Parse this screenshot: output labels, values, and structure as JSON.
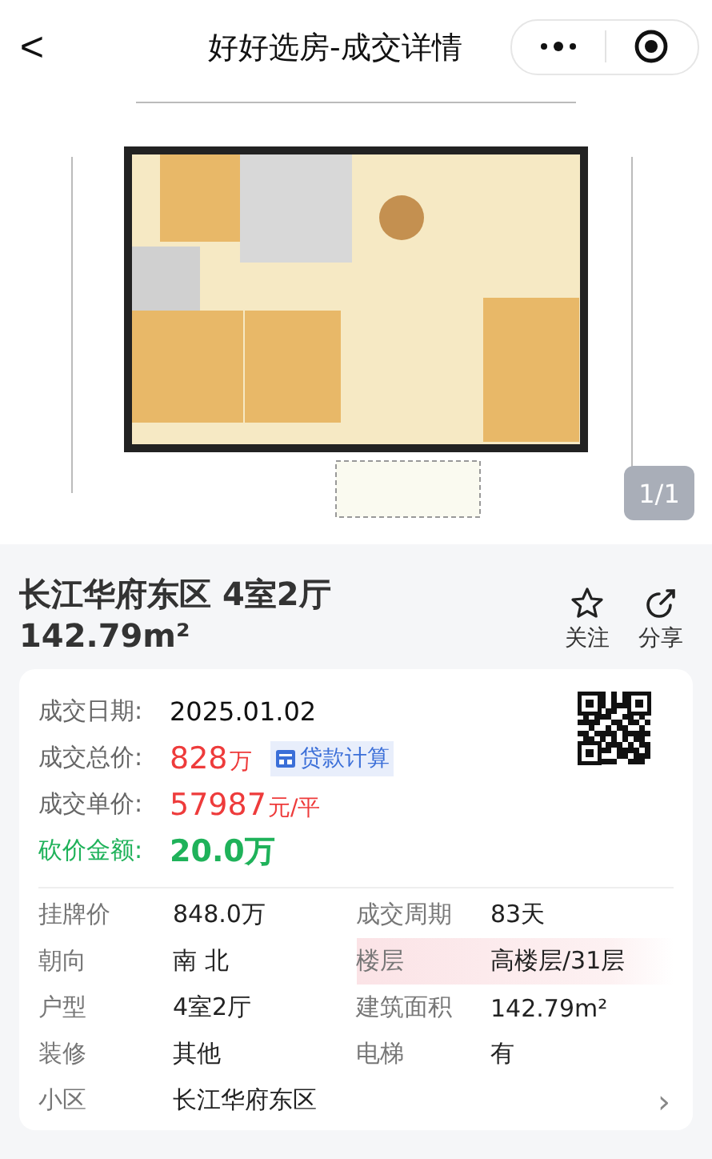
{
  "nav": {
    "back": "<",
    "title": "好好选房-成交详情"
  },
  "gallery": {
    "kind": "picture",
    "counter": "1/1"
  },
  "header": {
    "title": "长江华府东区 4室2厅",
    "area": "142.79m²",
    "actions": [
      {
        "kind": "star",
        "label": "关注"
      },
      {
        "kind": "share",
        "label": "分享"
      }
    ]
  },
  "deal": {
    "rows": [
      {
        "label": "成交日期:",
        "value": "2025.01.02",
        "kind": "plain"
      },
      {
        "label": "成交总价:",
        "value": "828",
        "unit": "万",
        "kind": "price",
        "link": "贷款计算"
      },
      {
        "label": "成交单价:",
        "value": "57987",
        "unit": "元/平",
        "kind": "price"
      },
      {
        "label": "砍价金额:",
        "value": "20.0万",
        "kind": "discount"
      }
    ]
  },
  "details": [
    {
      "label": "挂牌价",
      "value": "848.0万",
      "highlighted": false
    },
    {
      "label": "成交周期",
      "value": "83天",
      "highlighted": false
    },
    {
      "label": "朝向",
      "value": "南 北",
      "highlighted": false
    },
    {
      "label": "楼层",
      "value": "高楼层/31层",
      "highlighted": true
    },
    {
      "label": "户型",
      "value": "4室2厅",
      "highlighted": false
    },
    {
      "label": "建筑面积",
      "value": "142.79m²",
      "highlighted": false
    },
    {
      "label": "装修",
      "value": "其他",
      "highlighted": false
    },
    {
      "label": "电梯",
      "value": "有",
      "highlighted": false
    }
  ],
  "community": {
    "label": "小区",
    "value": "长江华府东区",
    "chevron": "›"
  }
}
